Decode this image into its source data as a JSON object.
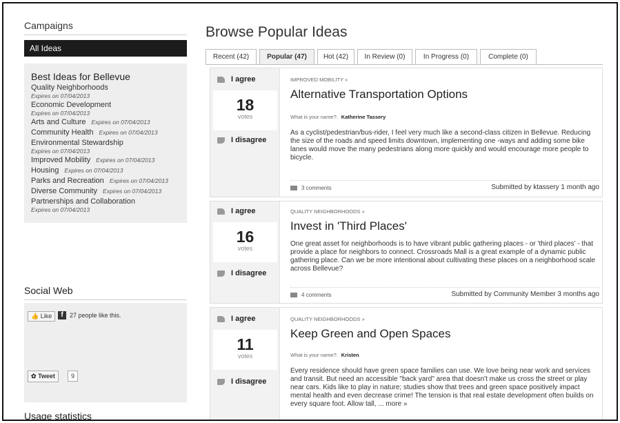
{
  "sidebar": {
    "campaigns_heading": "Campaigns",
    "all_ideas": "All Ideas",
    "group_title": "Best Ideas for Bellevue",
    "items": [
      {
        "label": "Quality Neighborhoods",
        "expires": "Expires on 07/04/2013"
      },
      {
        "label": "Economic Development",
        "expires": "Expires on 07/04/2013"
      },
      {
        "label": "Arts and Culture",
        "expires": "Expires on 07/04/2013"
      },
      {
        "label": "Community Health",
        "expires": "Expires on 07/04/2013"
      },
      {
        "label": "Environmental Stewardship",
        "expires": "Expires on 07/04/2013"
      },
      {
        "label": "Improved Mobility",
        "expires": "Expires on 07/04/2013"
      },
      {
        "label": "Housing",
        "expires": "Expires on 07/04/2013"
      },
      {
        "label": "Parks and Recreation",
        "expires": "Expires on 07/04/2013"
      },
      {
        "label": "Diverse Community",
        "expires": "Expires on 07/04/2013"
      },
      {
        "label": "Partnerships and Collaboration",
        "expires": "Expires on 07/04/2013"
      }
    ],
    "social_heading": "Social Web",
    "fb_like": "Like",
    "fb_icon": "f",
    "fb_count": "27 people like this.",
    "tweet": "Tweet",
    "tweet_count": "9",
    "usage_heading": "Usage statistics"
  },
  "main": {
    "title": "Browse Popular Ideas",
    "tabs": [
      {
        "label": "Recent (42)"
      },
      {
        "label": "Popular (47)"
      },
      {
        "label": "Hot (42)"
      },
      {
        "label": "In Review (0)"
      },
      {
        "label": "In Progress (0)"
      },
      {
        "label": "Complete (0)"
      }
    ],
    "ideas": [
      {
        "agree": "I agree",
        "disagree": "I disagree",
        "votes": "18",
        "votes_label": "votes",
        "category": "IMPROVED MOBILITY »",
        "title": "Alternative Transportation Options",
        "author_label": "What is your name?:",
        "author": "Katherine Tassery",
        "description": "As a cyclist/pedestrian/bus-rider, I feel very much like a second-class citizen in Bellevue. Reducing the size of the roads and speed limits downtown, implementing one -ways and adding some bike lanes would move the many pedestrians along more quickly and would encourage more people to bicycle.",
        "comments": "3 comments",
        "submitted": "Submitted by ktassery 1 month ago"
      },
      {
        "agree": "I agree",
        "disagree": "I disagree",
        "votes": "16",
        "votes_label": "votes",
        "category": "QUALITY NEIGHBORHOODS »",
        "title": "Invest in 'Third Places'",
        "description": "One great asset for neighborhoods is to have vibrant public gathering places - or 'third places' - that provide a place for neighbors to connect. Crossroads Mall is a great example of a dynamic public gathering place. Can we be more intentional about cultivating these places on a neighborhood scale across Bellevue?",
        "comments": "4 comments",
        "submitted": "Submitted by Community Member 3 months ago"
      },
      {
        "agree": "I agree",
        "disagree": "I disagree",
        "votes": "11",
        "votes_label": "votes",
        "category": "QUALITY NEIGHBORHOODS »",
        "title": "Keep Green and Open Spaces",
        "author_label": "What is your name?:",
        "author": "Kristen",
        "description": "Every residence should have green space families can use. We love being near work and services and transit. But need an accessible \"back yard\" area that doesn't make us cross the street or play near cars. Kids like to play in nature; studies show that trees and green space positively impact mental health and even decrease crime! The tension is that real estate development often builds on every square foot. Allow tall, ...",
        "more": "more »"
      }
    ]
  }
}
